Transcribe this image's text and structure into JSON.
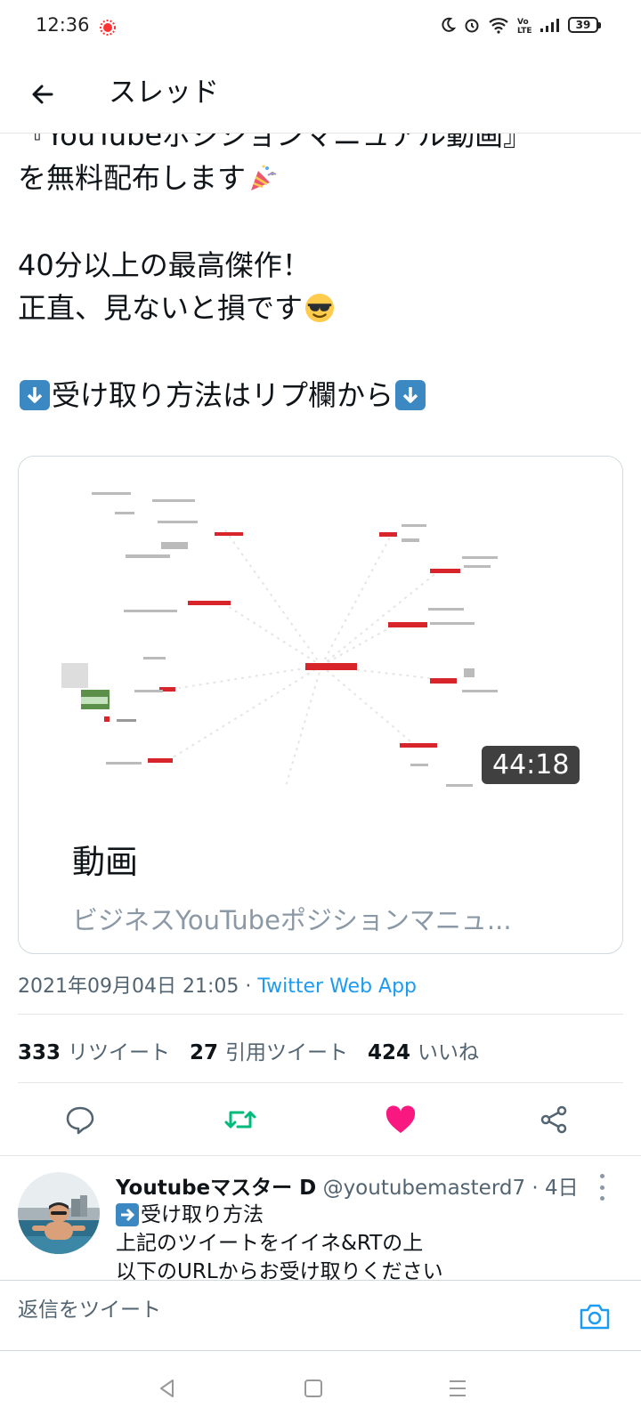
{
  "status_bar": {
    "time": "12:36",
    "battery": "39"
  },
  "header": {
    "title": "スレッド"
  },
  "tweet": {
    "lines": [
      "『YouTubeポジションマニュアル動画』",
      "を無料配布します",
      "40分以上の最高傑作！",
      "正直、見ないと損です",
      "受け取り方法はリプ欄から"
    ],
    "card": {
      "duration": "44:18",
      "title": "動画",
      "description": "ビジネスYouTubeポジションマニュ..."
    },
    "timestamp": "2021年09月04日 21:05",
    "separator": " · ",
    "source": "Twitter Web App",
    "stats": {
      "retweets_count": "333",
      "retweets_label": "リツイート",
      "quotes_count": "27",
      "quotes_label": "引用ツイート",
      "likes_count": "424",
      "likes_label": "いいね"
    }
  },
  "reply": {
    "name": "Youtubeマスター D",
    "handle": "@youtubemasterd7 · 4日",
    "lines": [
      "受け取り方法",
      "上記のツイートをイイネ&RTの上",
      "以下のURLからお受け取りください"
    ]
  },
  "compose": {
    "placeholder": "返信をツイート"
  },
  "colors": {
    "accent": "#1d9bf0",
    "retweet_active": "#00ba7c",
    "like_active": "#f91880",
    "muted": "#536471"
  }
}
